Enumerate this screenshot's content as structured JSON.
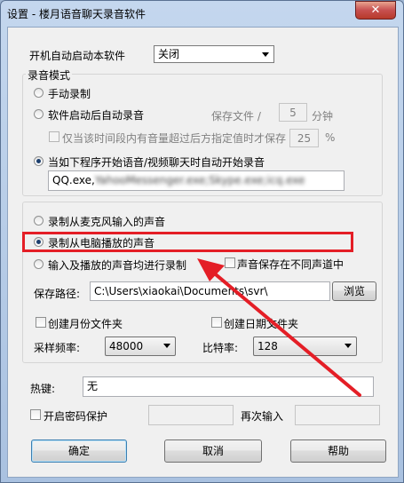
{
  "window": {
    "title": "设置 - 楼月语音聊天录音软件",
    "close_label": "✕"
  },
  "autostart": {
    "label": "开机自动启动本软件",
    "value": "关闭"
  },
  "record_mode": {
    "group_title": "录音模式",
    "manual_label": "手动录制",
    "auto_after_start_label": "软件启动后自动录音",
    "save_file_label": "保存文件 /",
    "save_minutes_value": "5",
    "minutes_unit": "分钟",
    "volume_only_label": "仅当该时间段内有音量超过后方指定值时才保存",
    "volume_value": "25",
    "percent_unit": "%",
    "auto_program_label": "当如下程序开始语音/视频聊天时自动开始录音",
    "programs_visible": "QQ.exe,",
    "programs_blurred": "YahooMessenger.exe;Skype.exe;icq.exe"
  },
  "source": {
    "mic_label": "录制从麦克风输入的声音",
    "pc_label": "录制从电脑播放的声音",
    "both_label": "输入及播放的声音均进行录制",
    "separate_channel_label": "声音保存在不同声道中",
    "save_path_label": "保存路径:",
    "save_path_value": "C:\\Users\\xiaokai\\Documents\\svr\\",
    "browse_label": "浏览",
    "monthly_folder_label": "创建月份文件夹",
    "daily_folder_label": "创建日期文件夹",
    "sample_rate_label": "采样频率:",
    "sample_rate_value": "48000",
    "bitrate_label": "比特率:",
    "bitrate_value": "128"
  },
  "hotkey": {
    "label": "热键:",
    "value": "无"
  },
  "password": {
    "enable_label": "开启密码保护",
    "confirm_label": "再次输入"
  },
  "buttons": {
    "ok": "确定",
    "cancel": "取消",
    "help": "帮助"
  },
  "colors": {
    "highlight": "#e41e26",
    "arrow": "#e41e26"
  }
}
